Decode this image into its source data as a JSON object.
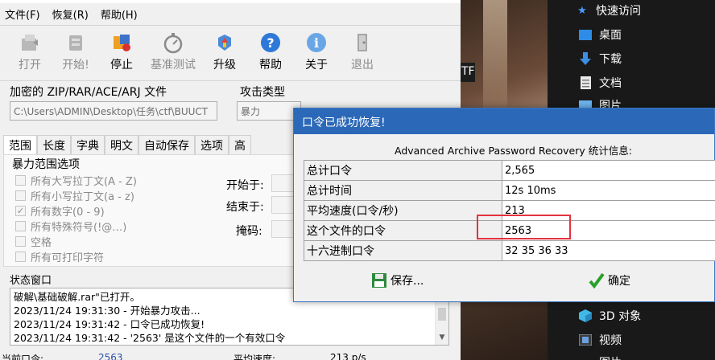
{
  "menu": [
    "文件(F)",
    "恢复(R)",
    "帮助(H)"
  ],
  "toolbar": [
    {
      "label": "打开",
      "icon": "open-icon",
      "enabled": false
    },
    {
      "label": "开始!",
      "icon": "start-icon",
      "enabled": false
    },
    {
      "label": "停止",
      "icon": "stop-icon",
      "enabled": true
    },
    {
      "label": "基准测试",
      "icon": "benchmark-icon",
      "enabled": false
    },
    {
      "label": "升级",
      "icon": "upgrade-icon",
      "enabled": true
    },
    {
      "label": "帮助",
      "icon": "help-icon",
      "enabled": true
    },
    {
      "label": "关于",
      "icon": "about-icon",
      "enabled": true
    },
    {
      "label": "退出",
      "icon": "exit-icon",
      "enabled": false
    }
  ],
  "file_group": {
    "label": "加密的 ZIP/RAR/ACE/ARJ 文件",
    "path": "C:\\Users\\ADMIN\\Desktop\\任务\\ctf\\BUUCT"
  },
  "attack_group": {
    "label": "攻击类型",
    "value": "暴力"
  },
  "tabs": [
    "范围",
    "长度",
    "字典",
    "明文",
    "自动保存",
    "选项",
    "高"
  ],
  "range_panel": {
    "title": "暴力范围选项",
    "options": [
      {
        "label": "所有大写拉丁文(A - Z)",
        "checked": false
      },
      {
        "label": "所有小写拉丁文(a - z)",
        "checked": false
      },
      {
        "label": "所有数字(0 - 9)",
        "checked": true
      },
      {
        "label": "所有特殊符号(!@…)",
        "checked": false
      },
      {
        "label": "空格",
        "checked": false
      },
      {
        "label": "所有可打印字符",
        "checked": false
      }
    ],
    "start_label": "开始于:",
    "end_label": "结束于:",
    "mask_label": "掩码:"
  },
  "status": {
    "title": "状态窗口",
    "lines": [
      "破解\\基础破解.rar\"已打开。",
      "2023/11/24 19:31:30 - 开始暴力攻击...",
      "2023/11/24 19:31:42 - 口令已成功恢复!",
      "2023/11/24 19:31:42 - '2563' 是这个文件的一个有效口令"
    ]
  },
  "bottom_bar": {
    "current_label": "当前口令:",
    "current_value": "2563",
    "speed_label": "平均速度:",
    "speed_value": "213 p/s"
  },
  "explorer": {
    "quick_access": "快速访问",
    "items": [
      "桌面",
      "下载",
      "文档",
      "图片",
      "3D 对象",
      "视频",
      "图片"
    ]
  },
  "bg_text": "TF",
  "dialog": {
    "title": "口令已成功恢复!",
    "heading": "Advanced Archive Password Recovery 统计信息:",
    "rows": [
      {
        "key": "总计口令",
        "value": "2,565"
      },
      {
        "key": "总计时间",
        "value": "12s 10ms"
      },
      {
        "key": "平均速度(口令/秒)",
        "value": "213"
      },
      {
        "key": "这个文件的口令",
        "value": "2563"
      },
      {
        "key": "十六进制口令",
        "value": "32 35 36 33"
      }
    ],
    "save_label": "保存...",
    "ok_label": "确定"
  }
}
